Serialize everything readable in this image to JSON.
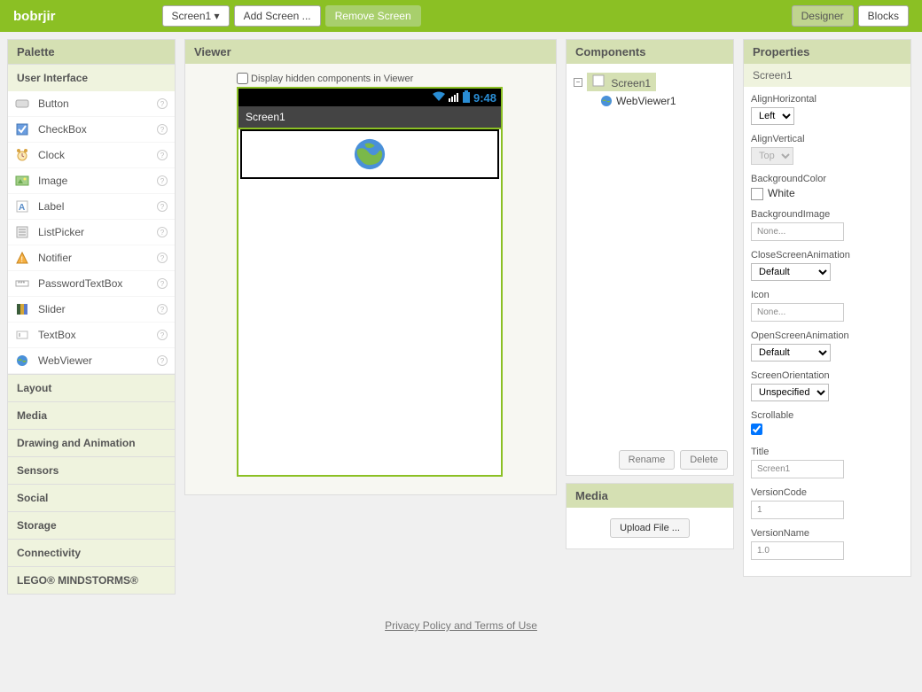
{
  "header": {
    "title": "bobrjir",
    "screen_btn": "Screen1 ▾",
    "add_screen": "Add Screen ...",
    "remove_screen": "Remove Screen",
    "designer": "Designer",
    "blocks": "Blocks"
  },
  "palette": {
    "title": "Palette",
    "categories": {
      "user_interface": "User Interface",
      "layout": "Layout",
      "media": "Media",
      "drawing": "Drawing and Animation",
      "sensors": "Sensors",
      "social": "Social",
      "storage": "Storage",
      "connectivity": "Connectivity",
      "lego": "LEGO® MINDSTORMS®"
    },
    "items": [
      {
        "label": "Button"
      },
      {
        "label": "CheckBox"
      },
      {
        "label": "Clock"
      },
      {
        "label": "Image"
      },
      {
        "label": "Label"
      },
      {
        "label": "ListPicker"
      },
      {
        "label": "Notifier"
      },
      {
        "label": "PasswordTextBox"
      },
      {
        "label": "Slider"
      },
      {
        "label": "TextBox"
      },
      {
        "label": "WebViewer"
      }
    ]
  },
  "viewer": {
    "title": "Viewer",
    "hidden_label": "Display hidden components in Viewer",
    "phone_time": "9:48",
    "phone_title": "Screen1"
  },
  "components": {
    "title": "Components",
    "root": "Screen1",
    "child": "WebViewer1",
    "rename": "Rename",
    "delete": "Delete"
  },
  "media": {
    "title": "Media",
    "upload": "Upload File ..."
  },
  "properties": {
    "title": "Properties",
    "subtitle": "Screen1",
    "align_h_label": "AlignHorizontal",
    "align_h_value": "Left",
    "align_v_label": "AlignVertical",
    "align_v_value": "Top",
    "bg_color_label": "BackgroundColor",
    "bg_color_value": "White",
    "bg_image_label": "BackgroundImage",
    "bg_image_value": "None...",
    "close_anim_label": "CloseScreenAnimation",
    "close_anim_value": "Default",
    "icon_label": "Icon",
    "icon_value": "None...",
    "open_anim_label": "OpenScreenAnimation",
    "open_anim_value": "Default",
    "orient_label": "ScreenOrientation",
    "orient_value": "Unspecified",
    "scrollable_label": "Scrollable",
    "title_label": "Title",
    "title_value": "Screen1",
    "vcode_label": "VersionCode",
    "vcode_value": "1",
    "vname_label": "VersionName",
    "vname_value": "1.0"
  },
  "footer": {
    "link": "Privacy Policy and Terms of Use"
  }
}
